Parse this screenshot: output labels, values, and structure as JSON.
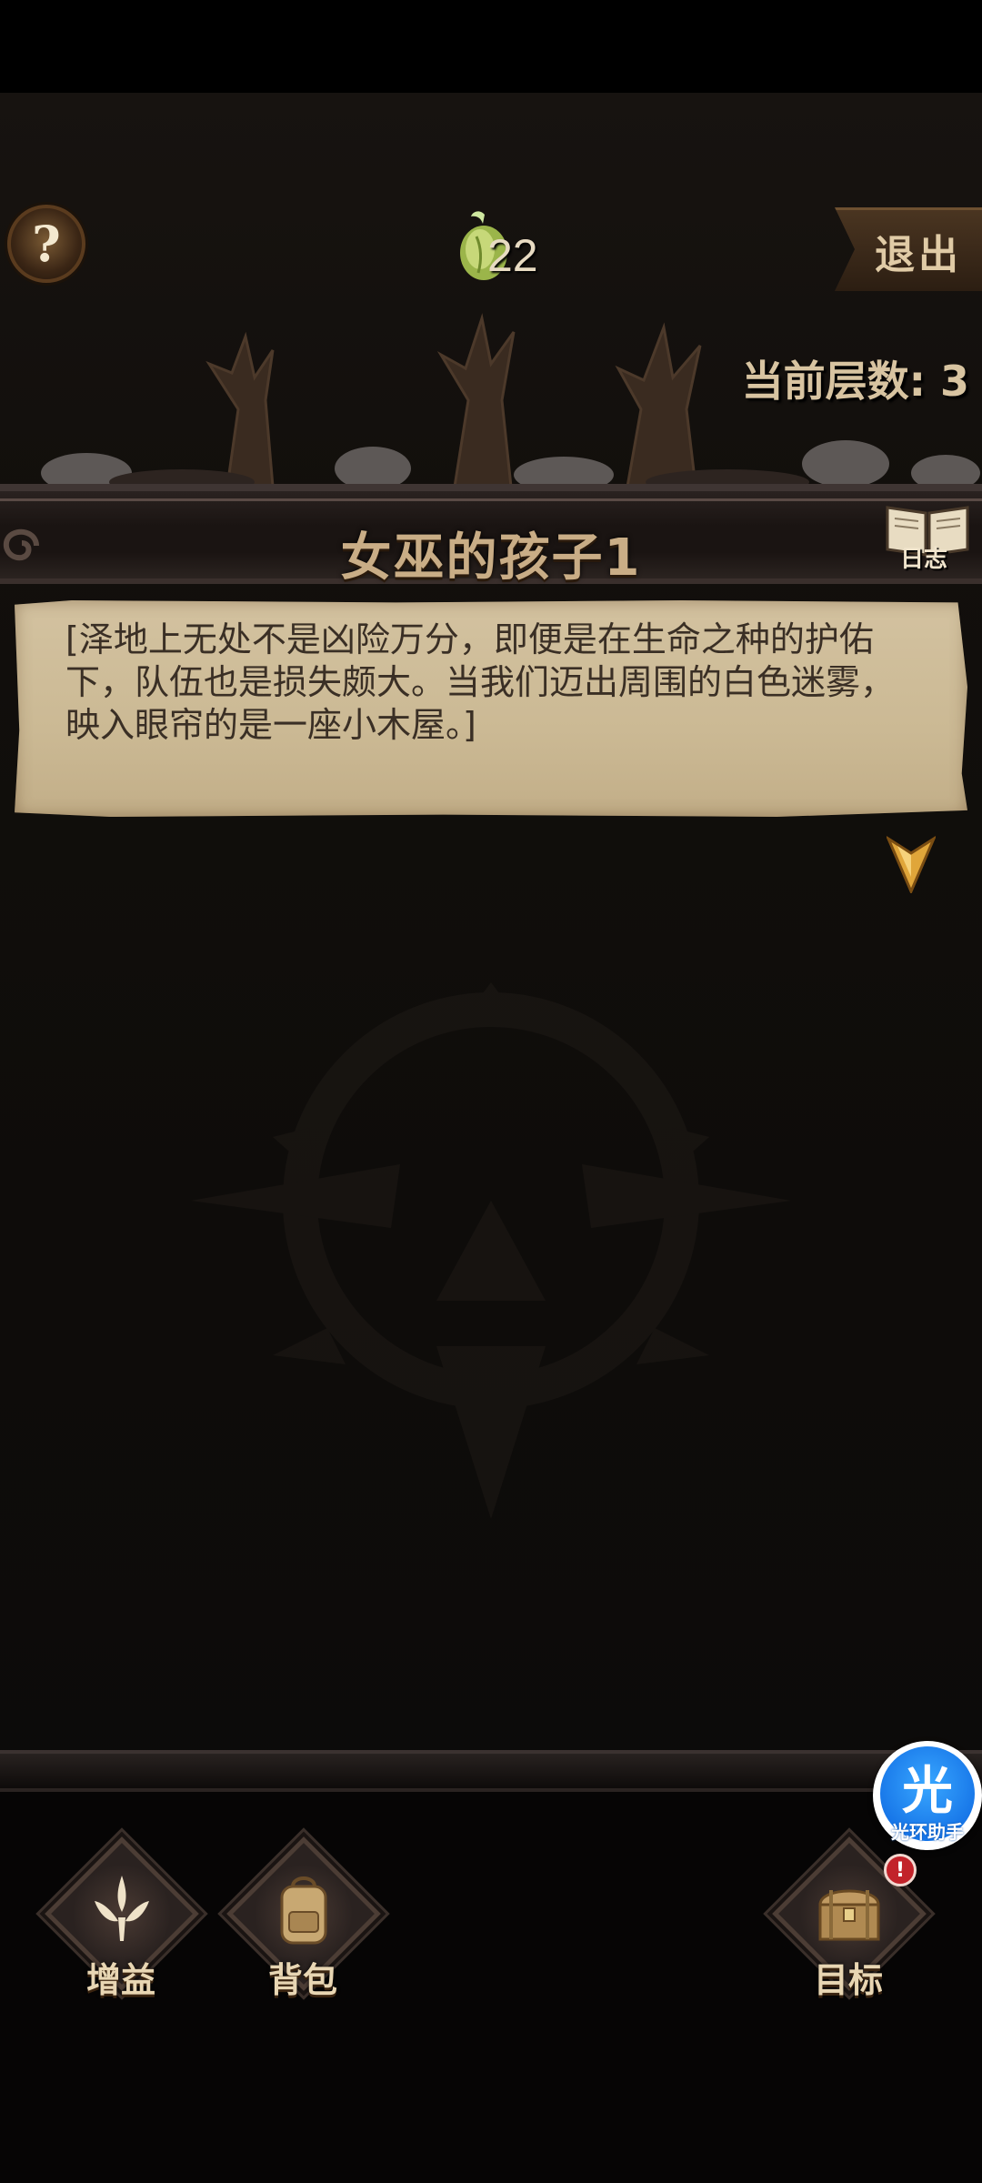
{
  "hud": {
    "help_label": "?",
    "seed_count": "22",
    "exit_label": "退出",
    "floor_label": "当前层数: 3"
  },
  "event": {
    "title": "女巫的孩子1",
    "log_label": "日志",
    "story": "[泽地上无处不是凶险万分，即便是在生命之种的护佑下，队伍也是损失颇大。当我们迈出周围的白色迷雾，映入眼帘的是一座小木屋。]"
  },
  "menu": {
    "buff_label": "增益",
    "bag_label": "背包",
    "goal_label": "目标",
    "goal_badge": "!"
  },
  "helper": {
    "glyph": "光",
    "name": "光环助手"
  },
  "colors": {
    "parchment": "#cbb994",
    "title_text": "#c9ad86",
    "helper_blue": "#1776e8",
    "badge_red": "#c2232a"
  }
}
